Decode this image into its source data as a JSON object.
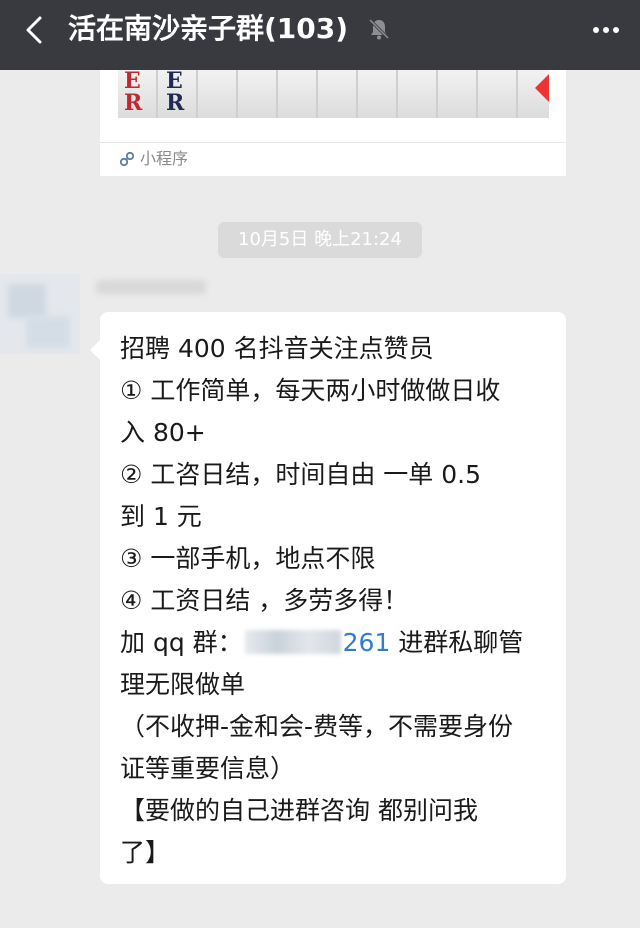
{
  "titlebar": {
    "back_icon": "chevron-left-icon",
    "title": "活在南沙亲子群(103)",
    "mute_icon": "bell-off-icon",
    "more_icon": "more-dots-icon"
  },
  "mini_program_card": {
    "label": "小程序",
    "thumbnail_letters": [
      "E",
      "R",
      "E",
      "R"
    ]
  },
  "timestamp": "10月5日 晚上21:24",
  "message": {
    "line1": "招聘 400 名抖音关注点赞员",
    "line2": "① 工作简单，每天两小时做做日收",
    "line3": "入 80+",
    "line4": "② 工咨日结，时间自由  一单 0.5",
    "line5": "到 1 元",
    "line6": "③ 一部手机，地点不限",
    "line7": "④ 工资日结 ，多劳多得！",
    "line8_prefix": "加 qq 群：",
    "line8_number_tail": "261",
    "line8_suffix": " 进群私聊管",
    "line9": "理无限做单",
    "line10": "（不收押-金和会-费等，不需要身份",
    "line11": "证等重要信息）",
    "line12": "【要做的自己进群咨询  都别问我",
    "line13": "了】"
  }
}
